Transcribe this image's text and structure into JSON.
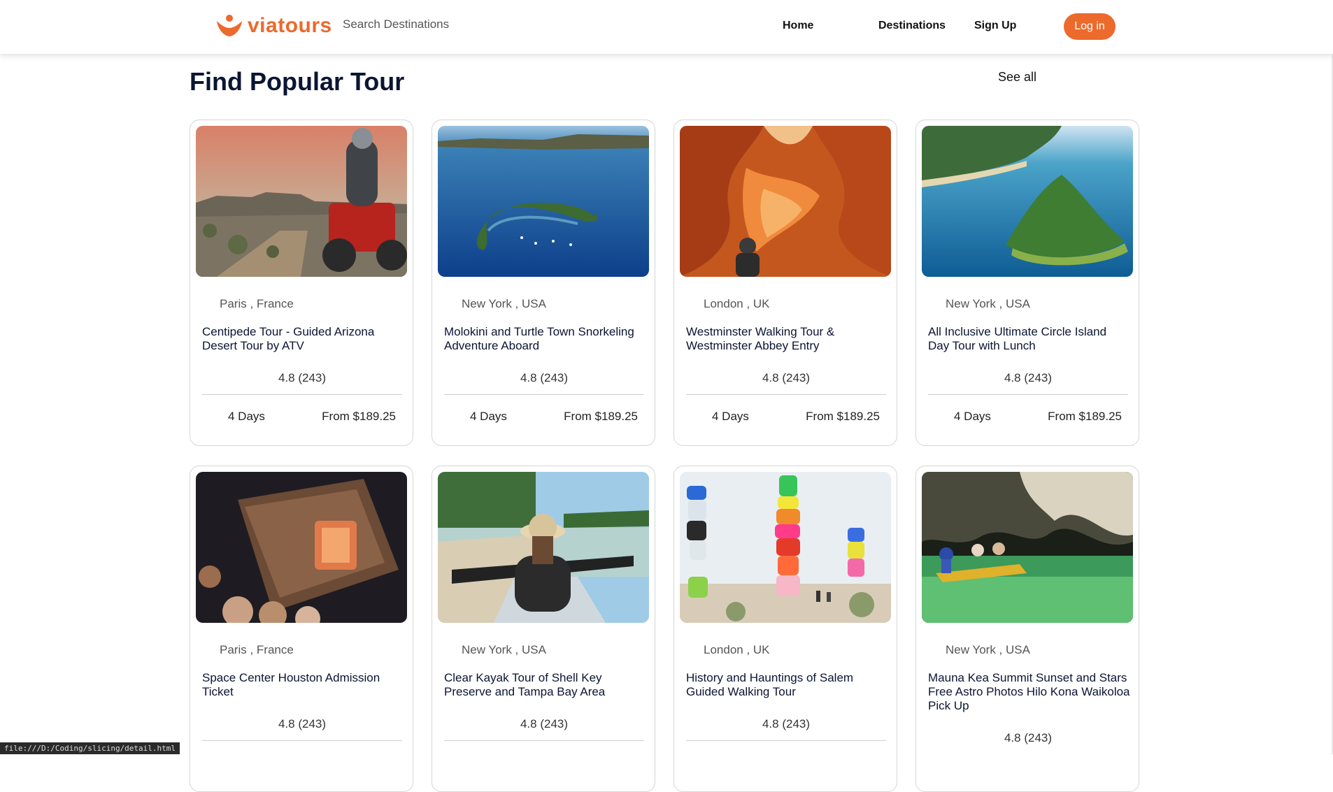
{
  "header": {
    "brand": "viatours",
    "search_placeholder": "Search Destinations",
    "nav": [
      "Home",
      "Destinations",
      "Sign Up"
    ],
    "login_label": "Log in",
    "accent_color": "#eb6a2c"
  },
  "section": {
    "title": "Find Popular Tour",
    "see_all": "See all"
  },
  "tours": [
    {
      "location": "Paris , France",
      "title": "Centipede Tour - Guided Arizona Desert Tour by ATV",
      "rating": "4.8 (243)",
      "duration": "4 Days",
      "price": "From $189.25",
      "image": "atv-desert-photo"
    },
    {
      "location": "New York , USA",
      "title": "Molokini and Turtle Town Snorkeling Adventure Aboard",
      "rating": "4.8 (243)",
      "duration": "4 Days",
      "price": "From $189.25",
      "image": "crater-island-ocean-photo"
    },
    {
      "location": "London , UK",
      "title": "Westminster Walking Tour & Westminster Abbey Entry",
      "rating": "4.8 (243)",
      "duration": "4 Days",
      "price": "From $189.25",
      "image": "sandstone-canyon-photo"
    },
    {
      "location": "New York , USA",
      "title": "All Inclusive Ultimate Circle Island Day Tour with Lunch",
      "rating": "4.8 (243)",
      "duration": "4 Days",
      "price": "From $189.25",
      "image": "tropical-island-photo"
    },
    {
      "location": "Paris , France",
      "title": "Space Center Houston Admission Ticket",
      "rating": "4.8 (243)",
      "duration": "",
      "price": "",
      "image": "space-capsule-exhibit-photo"
    },
    {
      "location": "New York , USA",
      "title": "Clear Kayak Tour of Shell Key Preserve and Tampa Bay Area",
      "rating": "4.8 (243)",
      "duration": "",
      "price": "",
      "image": "kayak-mangrove-photo"
    },
    {
      "location": "London , UK",
      "title": "History and Hauntings of Salem Guided Walking Tour",
      "rating": "4.8 (243)",
      "duration": "",
      "price": "",
      "image": "painted-rock-towers-photo"
    },
    {
      "location": "New York , USA",
      "title": "Mauna Kea Summit Sunset and Stars Free Astro Photos Hilo Kona Waikoloa Pick Up",
      "rating": "4.8 (243)",
      "duration": "",
      "price": "",
      "image": "sea-cave-boat-photo"
    }
  ],
  "status_bar": "file:///D:/Coding/slicing/detail.html"
}
